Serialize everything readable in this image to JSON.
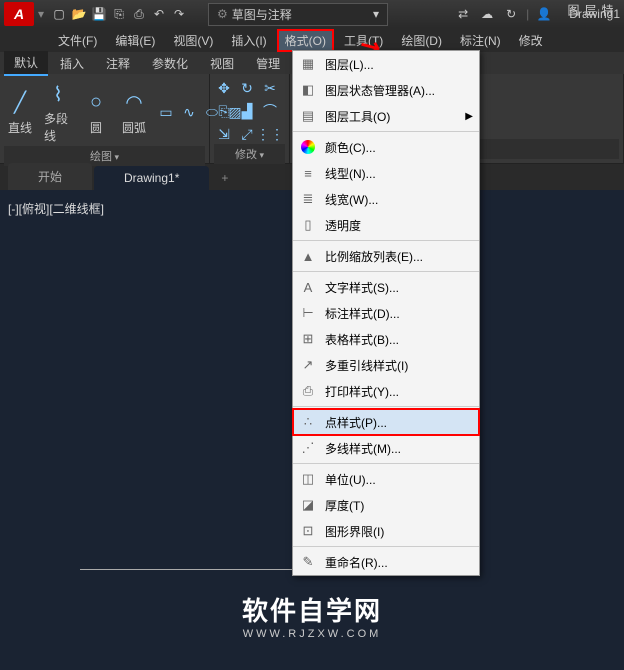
{
  "titlebar": {
    "logo": "A",
    "workspace": "草图与注释",
    "doc_title": "Drawing1"
  },
  "menubar": {
    "items": [
      "文件(F)",
      "编辑(E)",
      "视图(V)",
      "插入(I)",
      "格式(O)",
      "工具(T)",
      "绘图(D)",
      "标注(N)",
      "修改"
    ]
  },
  "ribbon_tabs": [
    "默认",
    "插入",
    "注释",
    "参数化",
    "视图",
    "管理"
  ],
  "panels": {
    "draw": {
      "title": "绘图",
      "line": "直线",
      "polyline": "多段线",
      "circle": "圆",
      "arc": "圆弧"
    },
    "modify": {
      "title": "修改"
    },
    "layer": {
      "title": "图层",
      "chars": [
        "图",
        "层",
        "特"
      ]
    }
  },
  "doctabs": {
    "start": "开始",
    "active": "Drawing1*",
    "add": "+"
  },
  "viewport_label": "[-][俯视][二维线框]",
  "dropdown": {
    "items": [
      {
        "icon": "▦",
        "label": "图层(L)...",
        "sep": false
      },
      {
        "icon": "◧",
        "label": "图层状态管理器(A)...",
        "sep": false
      },
      {
        "icon": "▤",
        "label": "图层工具(O)",
        "sub": true,
        "sep": true
      },
      {
        "icon": "◉",
        "label": "颜色(C)...",
        "color": "multi",
        "sep": false
      },
      {
        "icon": "≡",
        "label": "线型(N)...",
        "sep": false
      },
      {
        "icon": "≣",
        "label": "线宽(W)...",
        "sep": false
      },
      {
        "icon": "▯",
        "label": "透明度",
        "sep": true
      },
      {
        "icon": "▲",
        "label": "比例缩放列表(E)...",
        "sep": true
      },
      {
        "icon": "A",
        "label": "文字样式(S)...",
        "sep": false
      },
      {
        "icon": "⊢",
        "label": "标注样式(D)...",
        "sep": false
      },
      {
        "icon": "⊞",
        "label": "表格样式(B)...",
        "sep": false
      },
      {
        "icon": "↗",
        "label": "多重引线样式(I)",
        "sep": false
      },
      {
        "icon": "⎙",
        "label": "打印样式(Y)...",
        "sep": true
      },
      {
        "icon": "∴",
        "label": "点样式(P)...",
        "hl": true,
        "sep": false
      },
      {
        "icon": "⋰",
        "label": "多线样式(M)...",
        "sep": true
      },
      {
        "icon": "◫",
        "label": "单位(U)...",
        "sep": false
      },
      {
        "icon": "◪",
        "label": "厚度(T)",
        "sep": false
      },
      {
        "icon": "⊡",
        "label": "图形界限(I)",
        "sep": true
      },
      {
        "icon": "✎",
        "label": "重命名(R)...",
        "sep": false
      }
    ]
  },
  "watermark": {
    "main": "软件自学网",
    "sub": "WWW.RJZXW.COM"
  }
}
